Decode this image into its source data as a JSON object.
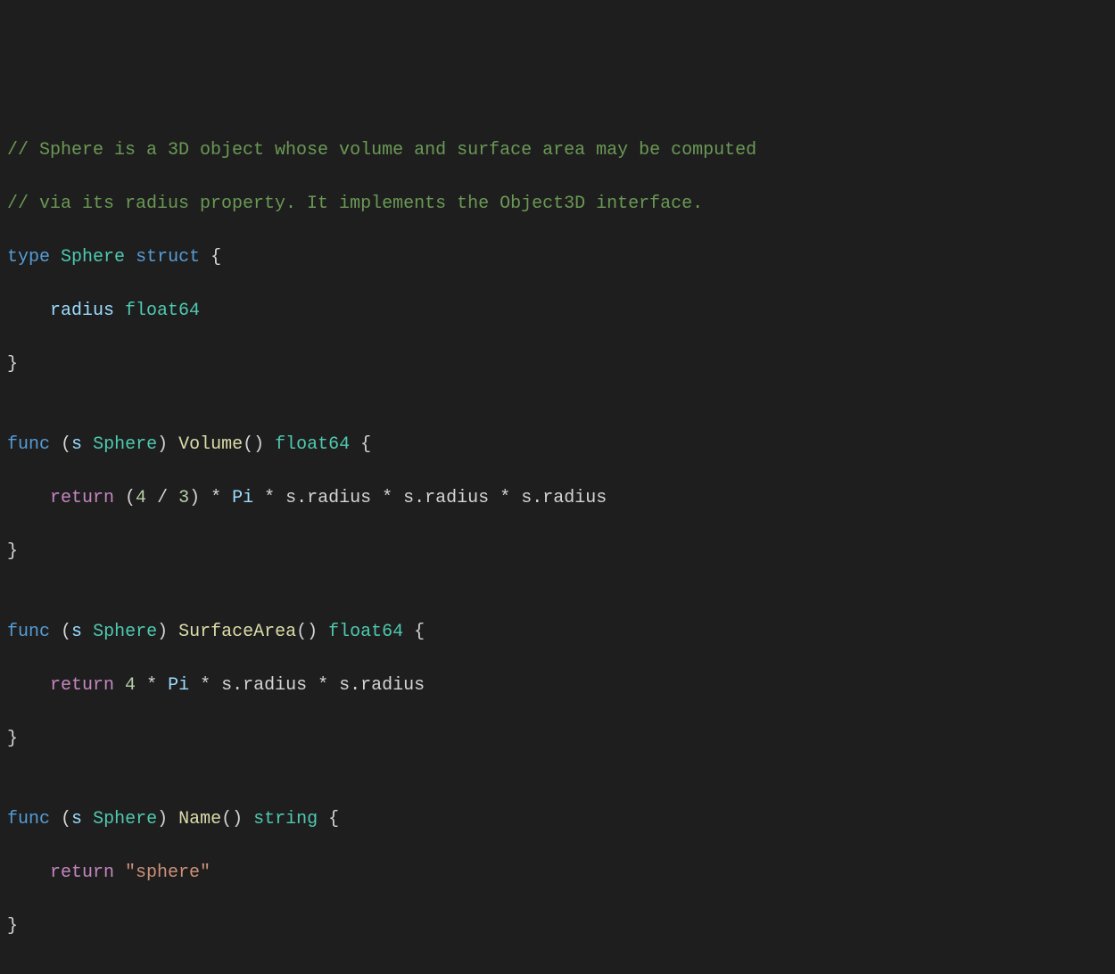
{
  "code": {
    "comment1": "// Sphere is a 3D object whose volume and surface area may be computed",
    "comment2": "// via its radius property. It implements the Object3D interface.",
    "kw_type": "type",
    "type_sphere": "Sphere",
    "kw_struct": "struct",
    "brace_open": " {",
    "field_radius": "    radius",
    "type_float64": "float64",
    "brace_close": "}",
    "blank": "",
    "kw_func": "func",
    "recv_open": " (",
    "recv_s": "s",
    "recv_type": "Sphere",
    "recv_close": ") ",
    "fn_volume": "Volume",
    "fn_surfacearea": "SurfaceArea",
    "fn_name": "Name",
    "parens": "()",
    "ret_float64": " float64",
    "ret_string": " string",
    "brace_open2": " {",
    "kw_return": "    return",
    "vol_expr_open": " (",
    "num4": "4",
    "op_div": " / ",
    "num3": "3",
    "vol_close_mul": ") * ",
    "pi": "Pi",
    "mul_s_radius": " * s.radius",
    "sa_lead": " ",
    "sa_mul_pi": " * ",
    "str_sphere": " \"sphere\""
  }
}
